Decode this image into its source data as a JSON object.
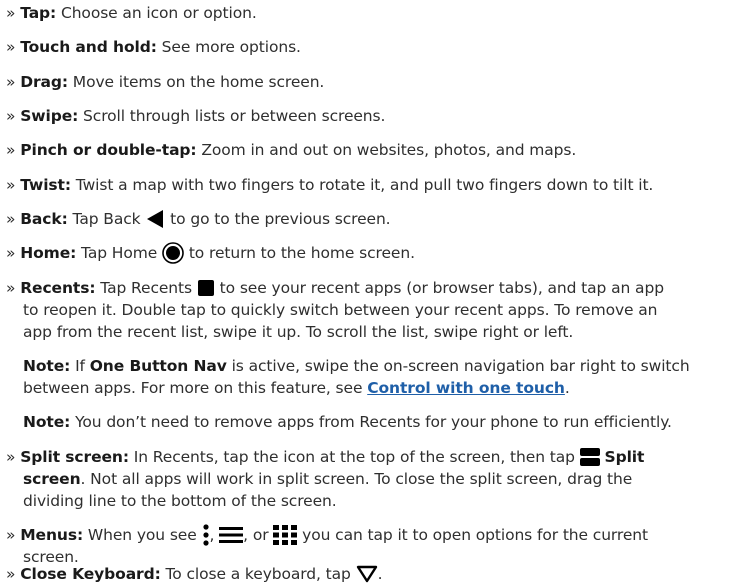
{
  "bullet": "»",
  "items": {
    "tap": {
      "label": "Tap:",
      "text": " Choose an icon or option."
    },
    "touch_hold": {
      "label": "Touch and hold:",
      "text": " See more options."
    },
    "drag": {
      "label": "Drag:",
      "text": " Move items on the home screen."
    },
    "swipe": {
      "label": "Swipe:",
      "text": " Scroll through lists or between screens."
    },
    "pinch": {
      "label": "Pinch or double-tap:",
      "text": " Zoom in and out on websites, photos, and maps."
    },
    "twist": {
      "label": "Twist:",
      "text": " Twist a map with two fingers to rotate it, and pull two fingers down to tilt it."
    },
    "back": {
      "label": "Back:",
      "before": " Tap Back ",
      "after": " to go to the previous screen."
    },
    "home": {
      "label": "Home:",
      "before": " Tap Home ",
      "after": " to return to the home screen."
    },
    "recents": {
      "label": "Recents:",
      "before": " Tap Recents ",
      "line1_after": " to see your recent apps (or browser tabs), and tap an app",
      "line2": "to reopen it. Double tap to quickly switch between your recent apps. To remove an",
      "line3": "app from the recent list, swipe it up. To scroll the list, swipe right or left."
    },
    "note1": {
      "label": "Note:",
      "a": " If ",
      "bold": "One Button Nav",
      "b": " is active, swipe the on-screen navigation bar right to switch",
      "line2_before": "between apps. For more on this feature, see ",
      "link": "Control with one touch",
      "line2_after": "."
    },
    "note2": {
      "label": "Note:",
      "text": " You don’t need to remove apps from Recents for your phone to run efficiently."
    },
    "split": {
      "label": "Split screen:",
      "line1_before": " In Recents, tap the icon at the top of the screen, then tap ",
      "line1_bold": "Split",
      "line2_bold": "screen",
      "line2_after": ". Not all apps will work in split screen. To close the split screen, drag the",
      "line3": "dividing line to the bottom of the screen."
    },
    "menus": {
      "label": "Menus:",
      "a": " When you see ",
      "b": ", ",
      "c": ", or ",
      "d": " you can tap it to open options for the current",
      "line2": "screen."
    },
    "keyboard": {
      "label": "Close Keyboard:",
      "text": " To close a keyboard, tap ",
      "end": "."
    }
  },
  "icons": [
    "back-triangle-icon",
    "home-circle-icon",
    "recents-square-icon",
    "split-screen-icon",
    "more-vert-icon",
    "hamburger-menu-icon",
    "grid-menu-icon",
    "keyboard-close-icon"
  ]
}
